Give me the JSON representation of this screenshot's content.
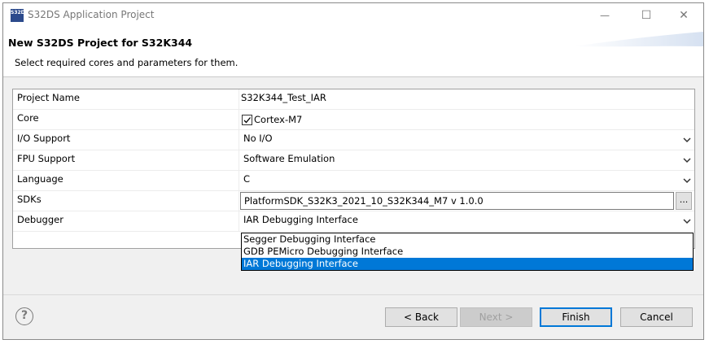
{
  "window": {
    "title": "S32DS Application Project",
    "icon_text": "S32DS",
    "minimize_glyph": "—",
    "maximize_glyph": "☐",
    "close_glyph": "✕"
  },
  "header": {
    "title": "New S32DS Project for S32K344",
    "message": "Select required cores and parameters for them."
  },
  "fields": {
    "project_name": {
      "label": "Project Name",
      "value": "S32K344_Test_IAR"
    },
    "core": {
      "label": "Core",
      "value": "Cortex-M7",
      "checked": true
    },
    "io_support": {
      "label": "I/O Support",
      "value": "No I/O"
    },
    "fpu_support": {
      "label": "FPU Support",
      "value": "Software Emulation"
    },
    "language": {
      "label": "Language",
      "value": "C"
    },
    "sdks": {
      "label": "SDKs",
      "value": "PlatformSDK_S32K3_2021_10_S32K344_M7 v 1.0.0",
      "browse_label": "..."
    },
    "debugger": {
      "label": "Debugger",
      "value": "IAR Debugging Interface"
    }
  },
  "debugger_dropdown": {
    "options": [
      "Segger Debugging Interface",
      "GDB PEMicro Debugging Interface",
      "IAR Debugging Interface"
    ],
    "selected_index": 2
  },
  "footer": {
    "help_glyph": "?",
    "back_label": "< Back",
    "next_label": "Next >",
    "finish_label": "Finish",
    "cancel_label": "Cancel"
  },
  "colors": {
    "selection": "#0078d7",
    "header_bg": "#ffffff",
    "dialog_bg": "#f0f0f0"
  }
}
